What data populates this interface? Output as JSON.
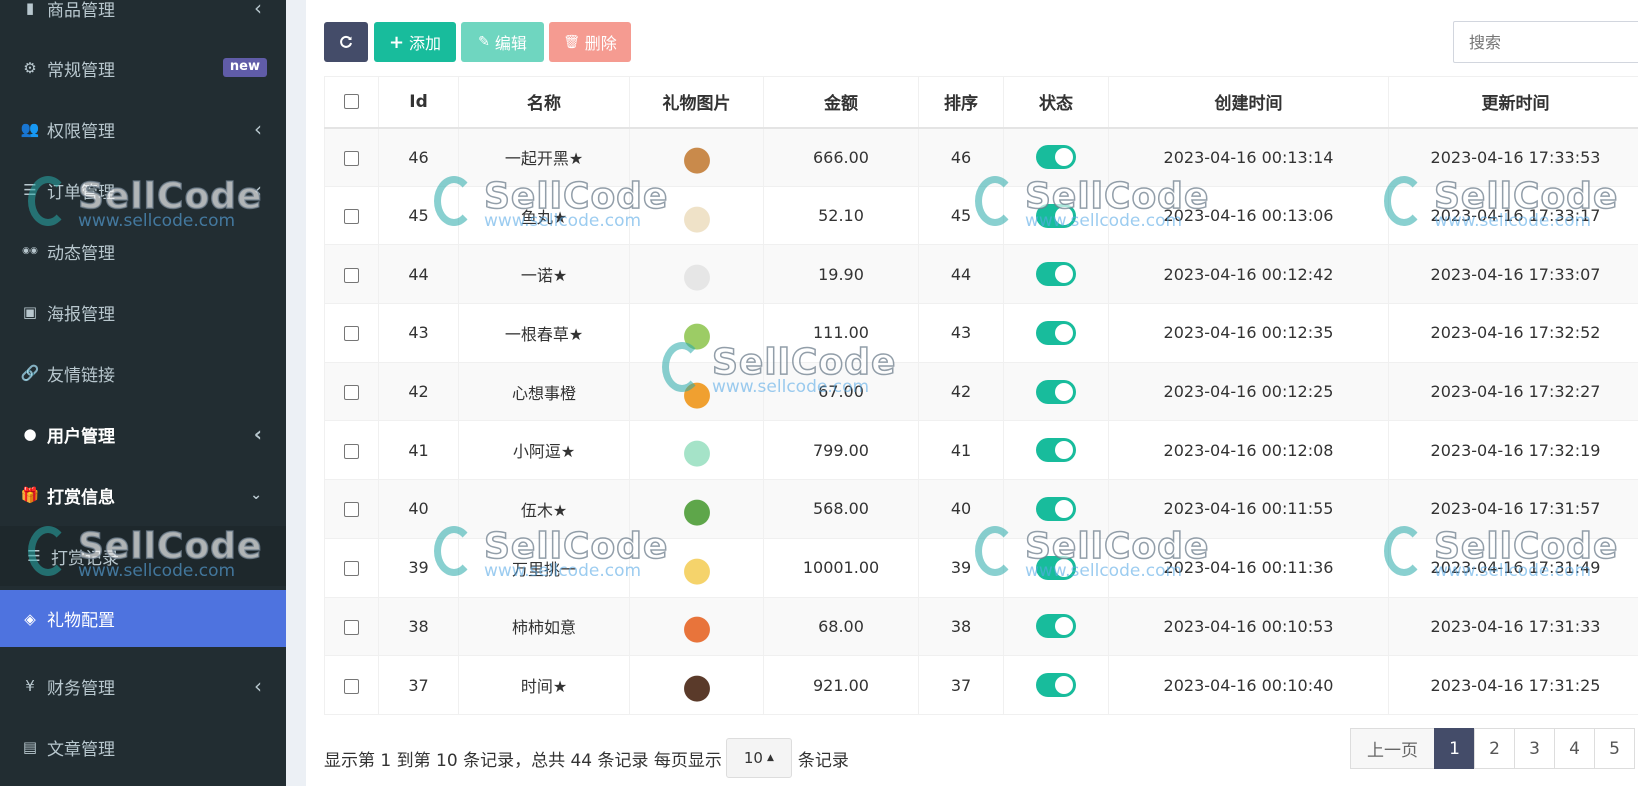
{
  "sidebar": {
    "items": [
      {
        "label": "商品管理",
        "icon": "book-icon",
        "arrow": "‹",
        "style": "normal"
      },
      {
        "label": "常规管理",
        "icon": "cogs-icon",
        "badge": "new",
        "style": "normal"
      },
      {
        "label": "权限管理",
        "icon": "group-icon",
        "arrow": "‹",
        "style": "normal"
      },
      {
        "label": "订单管理",
        "icon": "list-icon",
        "arrow": "‹",
        "style": "normal"
      },
      {
        "label": "动态管理",
        "icon": "tripadvisor-icon",
        "style": "normal"
      },
      {
        "label": "海报管理",
        "icon": "image-icon",
        "style": "normal"
      },
      {
        "label": "友情链接",
        "icon": "link-icon",
        "style": "normal"
      },
      {
        "label": "用户管理",
        "icon": "user-circle-icon",
        "arrow": "‹",
        "style": "bold"
      },
      {
        "label": "打赏信息",
        "icon": "gift-icon",
        "arrow": "⌄",
        "style": "bold"
      },
      {
        "label": "打赏记录",
        "icon": "list-icon",
        "style": "sub"
      },
      {
        "label": "礼物配置",
        "icon": "cube-icon",
        "style": "active"
      },
      {
        "label": "财务管理",
        "icon": "yen-icon",
        "arrow": "‹",
        "style": "normal"
      },
      {
        "label": "文章管理",
        "icon": "newspaper-icon",
        "style": "normal"
      }
    ]
  },
  "toolbar": {
    "refresh_icon": "refresh-icon",
    "add_label": "添加",
    "edit_label": "编辑",
    "delete_label": "删除"
  },
  "search": {
    "placeholder": "搜索"
  },
  "table": {
    "columns": [
      "Id",
      "名称",
      "礼物图片",
      "金额",
      "排序",
      "状态",
      "创建时间",
      "更新时间"
    ],
    "rows": [
      {
        "id": "46",
        "name": "一起开黑★",
        "amount": "666.00",
        "sort": "46",
        "status": true,
        "created": "2023-04-16 00:13:14",
        "updated": "2023-04-16 17:33:53",
        "img_color": "#c98a4b"
      },
      {
        "id": "45",
        "name": "鱼丸★",
        "amount": "52.10",
        "sort": "45",
        "status": true,
        "created": "2023-04-16 00:13:06",
        "updated": "2023-04-16 17:33:17",
        "img_color": "#efe2c8"
      },
      {
        "id": "44",
        "name": "一诺★",
        "amount": "19.90",
        "sort": "44",
        "status": true,
        "created": "2023-04-16 00:12:42",
        "updated": "2023-04-16 17:33:07",
        "img_color": "#e6e6e6"
      },
      {
        "id": "43",
        "name": "一根春草★",
        "amount": "111.00",
        "sort": "43",
        "status": true,
        "created": "2023-04-16 00:12:35",
        "updated": "2023-04-16 17:32:52",
        "img_color": "#9ccc65"
      },
      {
        "id": "42",
        "name": "心想事橙",
        "amount": "67.00",
        "sort": "42",
        "status": true,
        "created": "2023-04-16 00:12:25",
        "updated": "2023-04-16 17:32:27",
        "img_color": "#f0a030"
      },
      {
        "id": "41",
        "name": "小阿逗★",
        "amount": "799.00",
        "sort": "41",
        "status": true,
        "created": "2023-04-16 00:12:08",
        "updated": "2023-04-16 17:32:19",
        "img_color": "#a5e3c8"
      },
      {
        "id": "40",
        "name": "伍木★",
        "amount": "568.00",
        "sort": "40",
        "status": true,
        "created": "2023-04-16 00:11:55",
        "updated": "2023-04-16 17:31:57",
        "img_color": "#5ea64a"
      },
      {
        "id": "39",
        "name": "万里挑一",
        "amount": "10001.00",
        "sort": "39",
        "status": true,
        "created": "2023-04-16 00:11:36",
        "updated": "2023-04-16 17:31:49",
        "img_color": "#f5d36b"
      },
      {
        "id": "38",
        "name": "柿柿如意",
        "amount": "68.00",
        "sort": "38",
        "status": true,
        "created": "2023-04-16 00:10:53",
        "updated": "2023-04-16 17:31:33",
        "img_color": "#e8743b"
      },
      {
        "id": "37",
        "name": "时间★",
        "amount": "921.00",
        "sort": "37",
        "status": true,
        "created": "2023-04-16 00:10:40",
        "updated": "2023-04-16 17:31:25",
        "img_color": "#5a3a2a"
      }
    ]
  },
  "footer": {
    "summary": "显示第 1 到第 10 条记录，总共 44 条记录 每页显示",
    "page_size": "10",
    "suffix": "条记录"
  },
  "pagination": {
    "prev": "上一页",
    "pages": [
      "1",
      "2",
      "3",
      "4",
      "5"
    ],
    "active": "1"
  },
  "watermark": {
    "logo": "SellCode",
    "url": "www.sellcode.com"
  }
}
